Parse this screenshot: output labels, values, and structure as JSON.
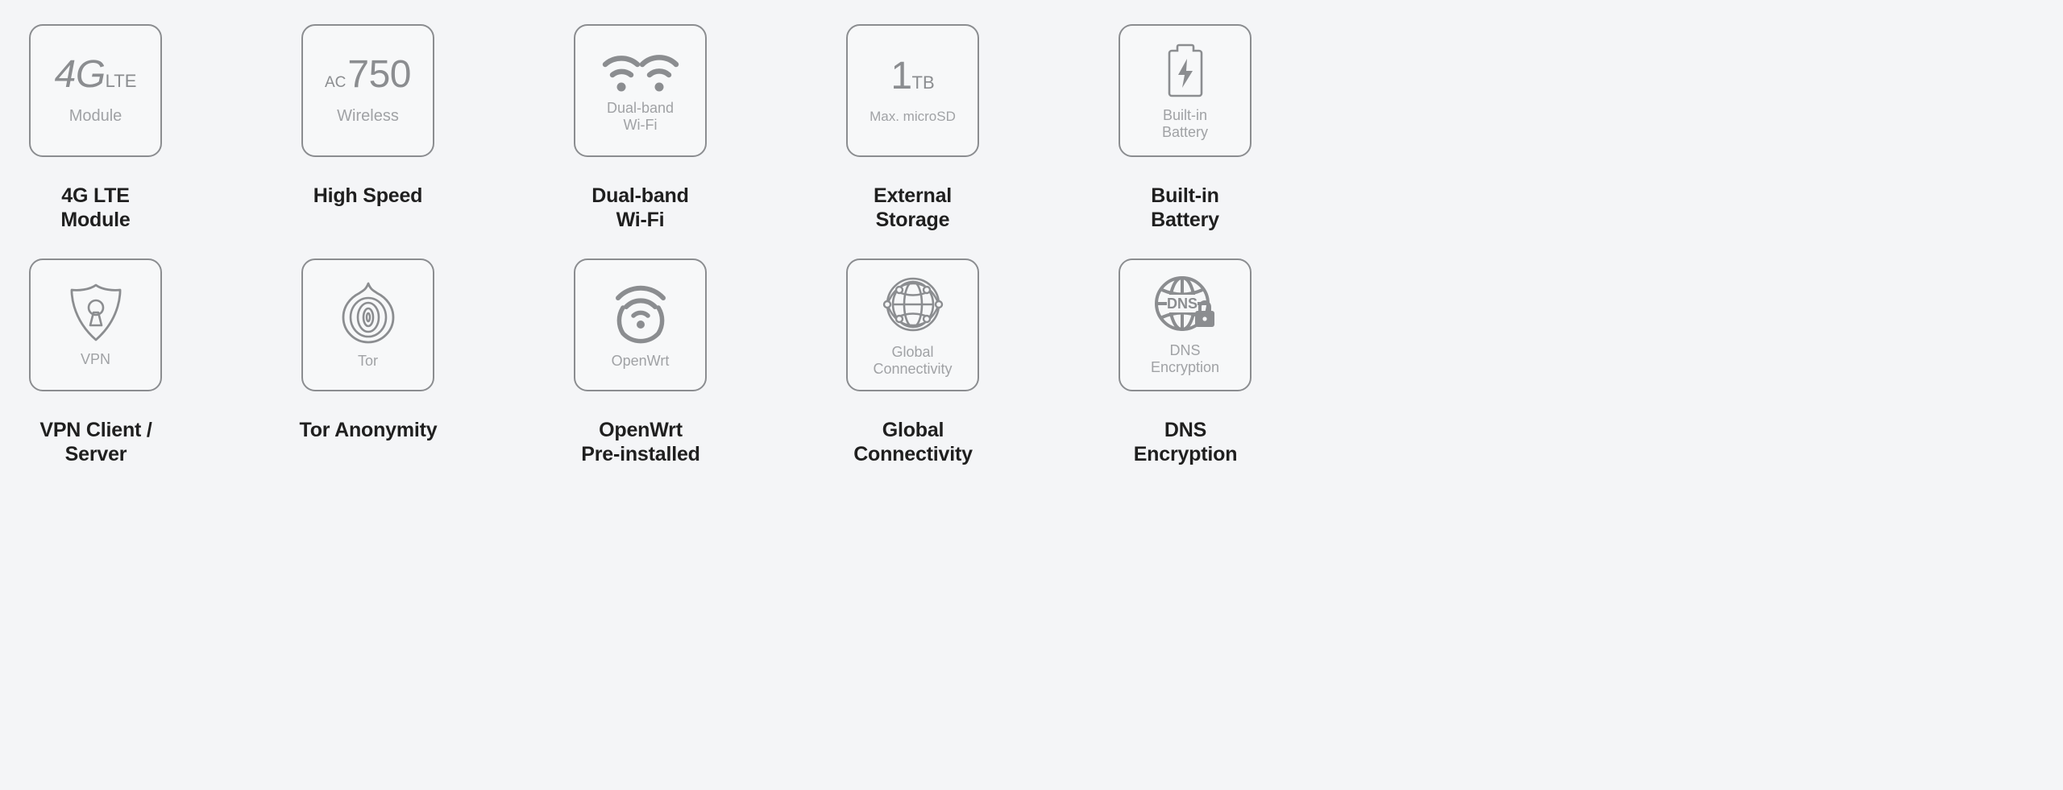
{
  "page": {
    "background_color": "#f4f5f7",
    "tile_fill_color": "#f7f8f9",
    "tile_border_color": "#8b8d90",
    "icon_color": "#8b8d90",
    "caption_color": "#1f1f1f"
  },
  "features": [
    {
      "id": "4g-lte-module",
      "icon": "4g-lte-text-icon",
      "tile": {
        "primary": "4G",
        "primary_suffix": "LTE",
        "secondary": "Module"
      },
      "caption_line1": "4G LTE",
      "caption_line2": "Module"
    },
    {
      "id": "high-speed",
      "icon": "ac750-text-icon",
      "tile": {
        "primary_prefix": "AC",
        "primary": "750",
        "secondary": "Wireless"
      },
      "caption_line1": "High Speed",
      "caption_line2": ""
    },
    {
      "id": "dual-band-wifi",
      "icon": "dual-wifi-signal-icon",
      "tile": {
        "secondary_line1": "Dual-band",
        "secondary_line2": "Wi-Fi"
      },
      "caption_line1": "Dual-band",
      "caption_line2": "Wi-Fi"
    },
    {
      "id": "external-storage",
      "icon": "1tb-text-icon",
      "tile": {
        "primary": "1",
        "primary_suffix": "TB",
        "secondary": "Max. microSD"
      },
      "caption_line1": "External",
      "caption_line2": "Storage"
    },
    {
      "id": "built-in-battery",
      "icon": "battery-bolt-icon",
      "tile": {
        "secondary_line1": "Built-in",
        "secondary_line2": "Battery"
      },
      "caption_line1": "Built-in",
      "caption_line2": "Battery"
    },
    {
      "id": "vpn-client-server",
      "icon": "shield-keyhole-icon",
      "tile": {
        "secondary": "VPN"
      },
      "caption_line1": "VPN Client /",
      "caption_line2": "Server"
    },
    {
      "id": "tor-anonymity",
      "icon": "tor-onion-icon",
      "tile": {
        "secondary": "Tor"
      },
      "caption_line1": "Tor Anonymity",
      "caption_line2": ""
    },
    {
      "id": "openwrt-preinstalled",
      "icon": "openwrt-signal-icon",
      "tile": {
        "secondary": "OpenWrt"
      },
      "caption_line1": "OpenWrt",
      "caption_line2": "Pre-installed"
    },
    {
      "id": "global-connectivity",
      "icon": "globe-network-icon",
      "tile": {
        "secondary_line1": "Global",
        "secondary_line2": "Connectivity"
      },
      "caption_line1": "Global",
      "caption_line2": "Connectivity"
    },
    {
      "id": "dns-encryption",
      "icon": "globe-dns-lock-icon",
      "tile": {
        "badge": "DNS",
        "secondary_line1": "DNS",
        "secondary_line2": "Encryption"
      },
      "caption_line1": "DNS",
      "caption_line2": "Encryption"
    }
  ]
}
